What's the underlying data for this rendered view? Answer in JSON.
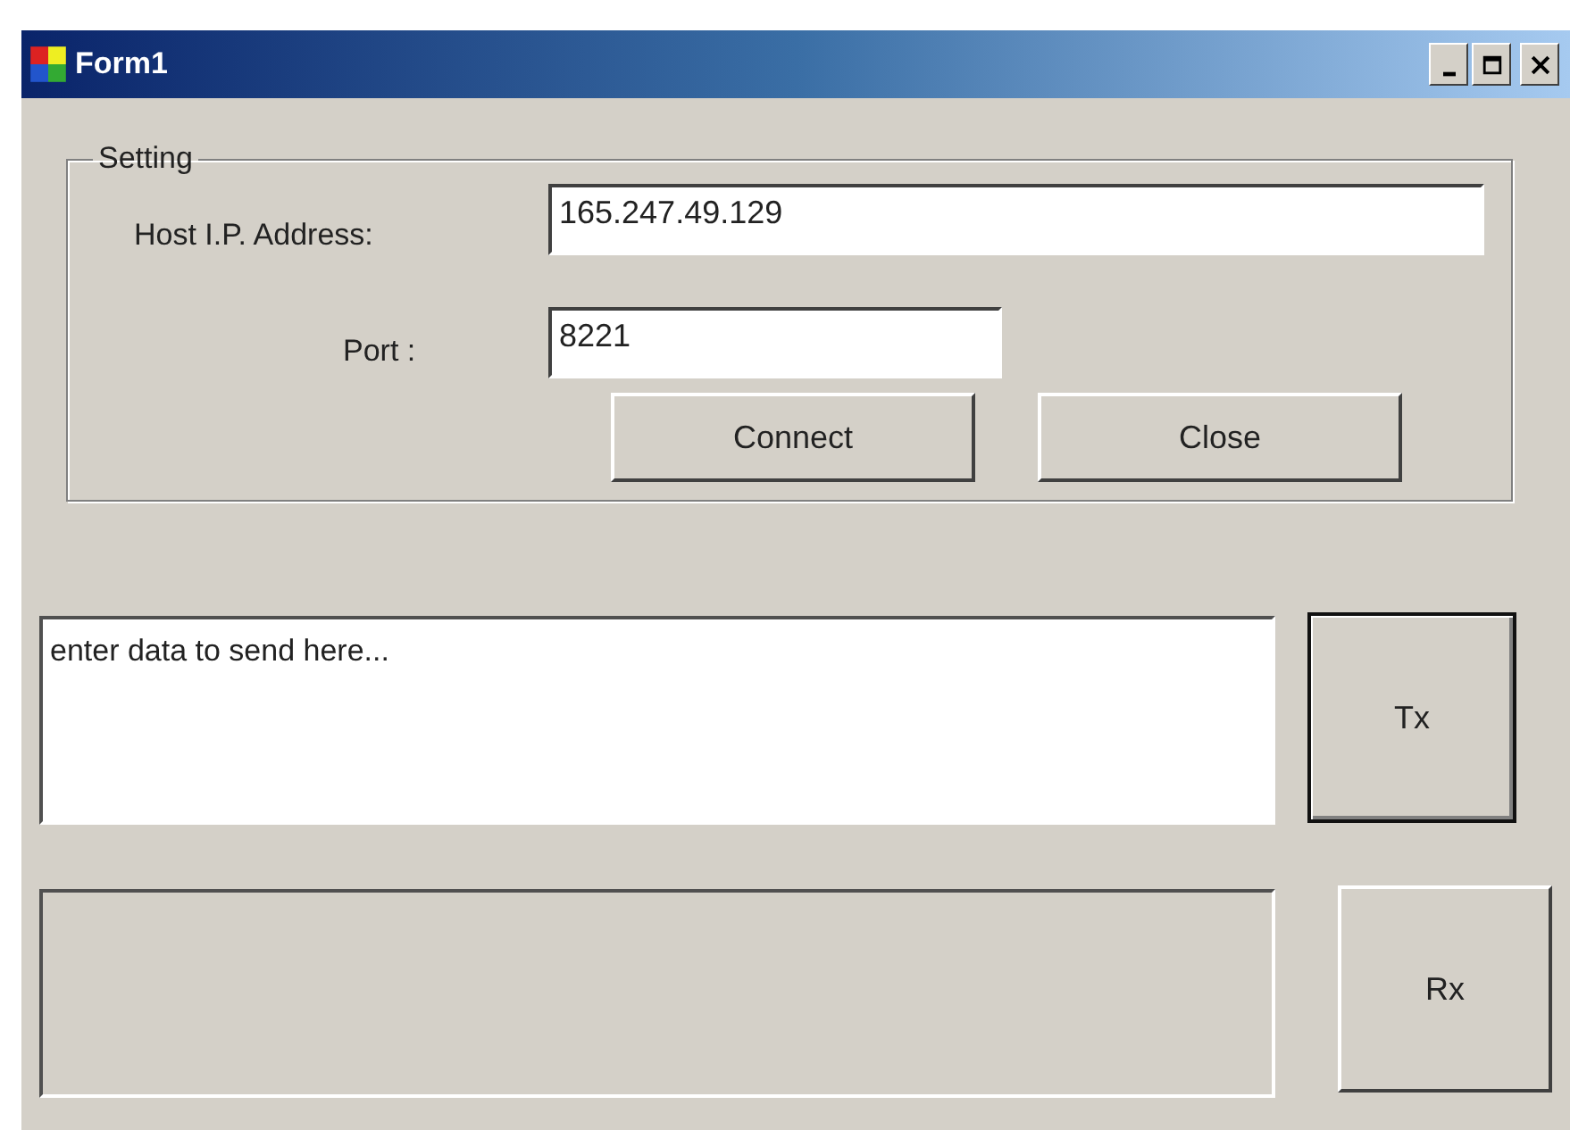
{
  "window": {
    "title": "Form1"
  },
  "setting": {
    "title": "Setting",
    "host": {
      "label": "Host I.P. Address:",
      "value": "165.247.49.129"
    },
    "port": {
      "label": "Port :",
      "value": "8221"
    },
    "buttons": [
      {
        "label": "Connect"
      },
      {
        "label": "Close"
      }
    ]
  },
  "send": {
    "value": "enter data to send here...",
    "button": {
      "label": "Tx",
      "default": true
    }
  },
  "receive": {
    "disabled": true,
    "button": {
      "label": "Rx",
      "default": false
    }
  }
}
